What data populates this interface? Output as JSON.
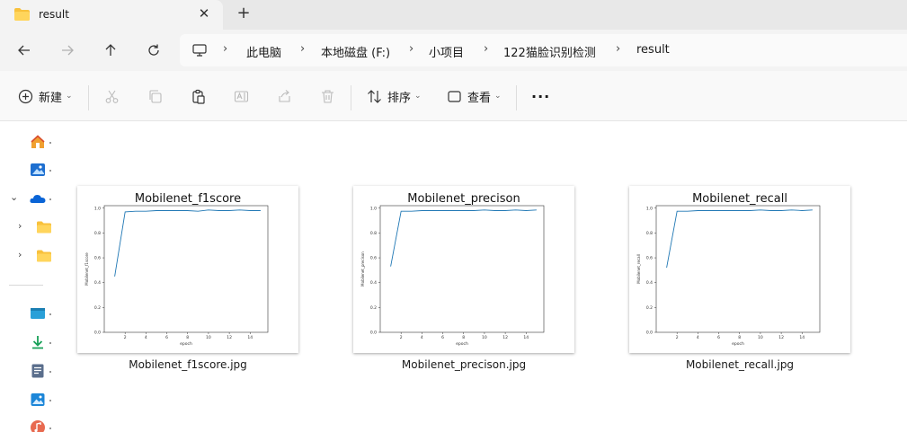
{
  "window": {
    "tab_title": "result",
    "tab_close_icon": "close-icon",
    "new_tab_icon": "plus-icon"
  },
  "nav": {
    "back_icon": "arrow-left-icon",
    "forward_icon": "arrow-right-icon",
    "up_icon": "arrow-up-icon",
    "refresh_icon": "refresh-icon",
    "pc_icon": "monitor-icon",
    "breadcrumb": [
      "此电脑",
      "本地磁盘 (F:)",
      "小项目",
      "122猫脸识别检测",
      "result"
    ]
  },
  "toolbar": {
    "new_label": "新建",
    "sort_label": "排序",
    "view_label": "查看",
    "more_label": "···",
    "icons": [
      "cut-icon",
      "copy-icon",
      "paste-icon",
      "rename-icon",
      "share-icon",
      "delete-icon"
    ]
  },
  "sidebar": {
    "icons": [
      "home-icon",
      "gallery-icon",
      "onedrive-icon",
      "folder-icon",
      "folder-icon",
      "desktop-icon",
      "downloads-icon",
      "documents-icon",
      "pictures-icon",
      "music-icon"
    ]
  },
  "files": [
    {
      "name": "Mobilenet_f1score.jpg"
    },
    {
      "name": "Mobilenet_precison.jpg"
    },
    {
      "name": "Mobilenet_recall.jpg"
    }
  ],
  "colors": {
    "accent": "#0067c0",
    "folder": "#f8c13c",
    "line": "#1f77b4"
  },
  "chart_data": [
    {
      "type": "line",
      "title": "Mobilenet_f1score",
      "xlabel": "epoch",
      "ylabel": "Mobilenet_f1score",
      "x": [
        1,
        2,
        3,
        4,
        5,
        6,
        7,
        8,
        9,
        10,
        11,
        12,
        13,
        14,
        15
      ],
      "values": [
        0.45,
        0.97,
        0.975,
        0.975,
        0.98,
        0.98,
        0.98,
        0.98,
        0.975,
        0.985,
        0.98,
        0.98,
        0.985,
        0.98,
        0.98
      ],
      "xlim": [
        0,
        15.7
      ],
      "ylim": [
        0,
        1.02
      ],
      "xticks": [
        "2",
        "4",
        "6",
        "8",
        "10",
        "12",
        "14"
      ],
      "yticks": [
        "0.0",
        "0.2",
        "0.4",
        "0.6",
        "0.8",
        "1.0"
      ]
    },
    {
      "type": "line",
      "title": "Mobilenet_precison",
      "xlabel": "epoch",
      "ylabel": "Mobilenet_precison",
      "x": [
        1,
        2,
        3,
        4,
        5,
        6,
        7,
        8,
        9,
        10,
        11,
        12,
        13,
        14,
        15
      ],
      "values": [
        0.53,
        0.975,
        0.975,
        0.98,
        0.98,
        0.98,
        0.98,
        0.98,
        0.98,
        0.985,
        0.98,
        0.98,
        0.985,
        0.98,
        0.985
      ],
      "xlim": [
        0,
        15.7
      ],
      "ylim": [
        0,
        1.02
      ],
      "xticks": [
        "2",
        "4",
        "6",
        "8",
        "10",
        "12",
        "14"
      ],
      "yticks": [
        "0.0",
        "0.2",
        "0.4",
        "0.6",
        "0.8",
        "1.0"
      ]
    },
    {
      "type": "line",
      "title": "Mobilenet_recall",
      "xlabel": "epoch",
      "ylabel": "Mobilenet_recall",
      "x": [
        1,
        2,
        3,
        4,
        5,
        6,
        7,
        8,
        9,
        10,
        11,
        12,
        13,
        14,
        15
      ],
      "values": [
        0.52,
        0.975,
        0.975,
        0.98,
        0.98,
        0.98,
        0.98,
        0.98,
        0.98,
        0.985,
        0.98,
        0.98,
        0.985,
        0.98,
        0.985
      ],
      "xlim": [
        0,
        15.7
      ],
      "ylim": [
        0,
        1.02
      ],
      "xticks": [
        "2",
        "4",
        "6",
        "8",
        "10",
        "12",
        "14"
      ],
      "yticks": [
        "0.0",
        "0.2",
        "0.4",
        "0.6",
        "0.8",
        "1.0"
      ]
    }
  ]
}
